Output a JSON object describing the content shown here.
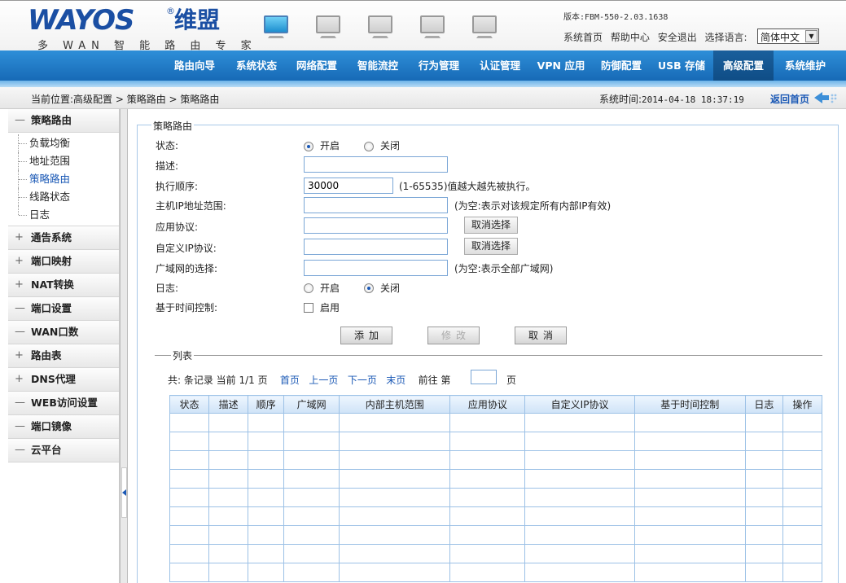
{
  "header": {
    "logo_text": "WAYOS",
    "logo_cn": "维盟",
    "logo_reg": "®",
    "logo_tagline": "多 WAN 智 能 路 由 专 家",
    "version": "版本:FBM-550-2.03.1638",
    "links": [
      "系统首页",
      "帮助中心",
      "安全退出",
      "选择语言:"
    ],
    "language": "简体中文",
    "language_arrow": "▼"
  },
  "nav": [
    "路由向导",
    "系统状态",
    "网络配置",
    "智能流控",
    "行为管理",
    "认证管理",
    "VPN 应用",
    "防御配置",
    "USB 存储",
    "高级配置",
    "系统维护"
  ],
  "breadcrumb": "当前位置:高级配置 > 策略路由 > 策略路由",
  "system_time_label": "系统时间:",
  "system_time": "2014-04-18 18:37:19",
  "home_link": "返回首页",
  "sidebar": {
    "sections": [
      {
        "sym": "—",
        "label": "策略路由"
      },
      {
        "sym": "+",
        "label": "通告系统"
      },
      {
        "sym": "+",
        "label": "端口映射"
      },
      {
        "sym": "+",
        "label": "NAT转换"
      },
      {
        "sym": "—",
        "label": "端口设置"
      },
      {
        "sym": "—",
        "label": "WAN口数"
      },
      {
        "sym": "+",
        "label": "路由表"
      },
      {
        "sym": "+",
        "label": "DNS代理"
      },
      {
        "sym": "—",
        "label": "WEB访问设置"
      },
      {
        "sym": "—",
        "label": "端口镜像"
      },
      {
        "sym": "—",
        "label": "云平台"
      }
    ],
    "sub_items": [
      "负载均衡",
      "地址范围",
      "策略路由",
      "线路状态",
      "日志"
    ]
  },
  "form": {
    "legend": "策略路由",
    "status_label": "状态:",
    "on": "开启",
    "off": "关闭",
    "desc_label": "描述:",
    "order_label": "执行顺序:",
    "order_value": "30000",
    "order_hint": "(1-65535)值越大越先被执行。",
    "host_label": "主机IP地址范围:",
    "host_hint": "(为空:表示对该规定所有内部IP有效)",
    "app_label": "应用协议:",
    "cancel_select": "取消选择",
    "custom_label": "自定义IP协议:",
    "wan_label": "广域网的选择:",
    "wan_hint": "(为空:表示全部广域网)",
    "log_label": "日志:",
    "time_label": "基于时间控制:",
    "enable": "启用",
    "add_btn": "添加",
    "modify_btn": "修改",
    "cancel_btn": "取消"
  },
  "list": {
    "legend": "列表",
    "pager_prefix": "共: 条记录 当前 1/1 页",
    "first": "首页",
    "prev": "上一页",
    "next": "下一页",
    "last": "末页",
    "goto": "前往 第",
    "page_suffix": "页",
    "columns": [
      "状态",
      "描述",
      "顺序",
      "广域网",
      "内部主机范围",
      "应用协议",
      "自定义IP协议",
      "基于时间控制",
      "日志",
      "操作"
    ]
  }
}
